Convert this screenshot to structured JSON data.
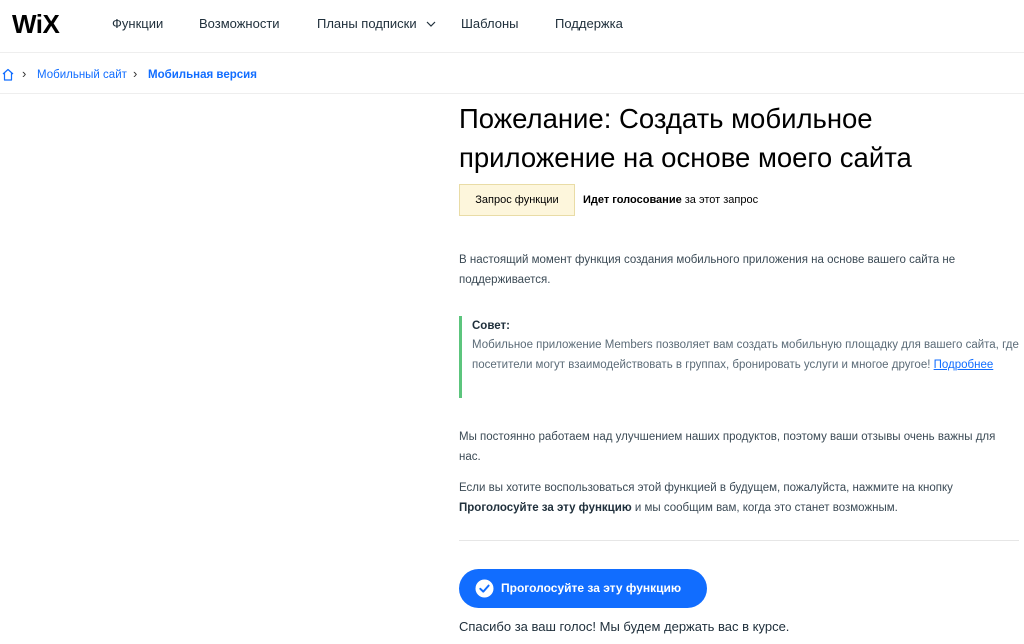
{
  "brand": {
    "logo": "WiX"
  },
  "nav": {
    "items": [
      "Функции",
      "Возможности",
      "Планы подписки",
      "Шаблоны",
      "Поддержка"
    ]
  },
  "breadcrumb": {
    "items": [
      "Мобильный сайт",
      "Мобильная версия"
    ]
  },
  "article": {
    "title": "Пожелание: Создать мобильное приложение на основе моего сайта",
    "badge": "Запрос функции",
    "status_bold": "Идет голосование",
    "status_rest": " за этот запрос",
    "intro": "В настоящий момент функция создания мобильного приложения на основе вашего сайта не поддерживается.",
    "tip": {
      "title": "Совет:",
      "text": "Мобильное приложение Members позволяет вам создать мобильную площадку для вашего сайта, где посетители могут взаимодействовать в группах, бронировать услуги и многое другое! ",
      "link": "Подробнее"
    },
    "feedback": "Мы постоянно работаем над улучшением наших продуктов, поэтому ваши отзывы очень важны для нас.",
    "vote_text_before": "Если вы хотите воспользоваться этой функцией в будущем, пожалуйста, нажмите на кнопку ",
    "vote_text_bold": "Проголосуйте за эту функцию",
    "vote_text_after": " и мы сообщим вам, когда это станет возможным.",
    "vote_button": "Проголосуйте за эту функцию",
    "thanks": "Спасибо за ваш голос! Мы будем держать вас в курсе."
  },
  "colors": {
    "accent": "#116dff",
    "tip_border": "#5cc57d",
    "badge_bg": "#fdf6dc"
  },
  "icons": [
    "home-icon",
    "chevron-right-icon",
    "chevron-down-icon",
    "check-circle-icon"
  ]
}
